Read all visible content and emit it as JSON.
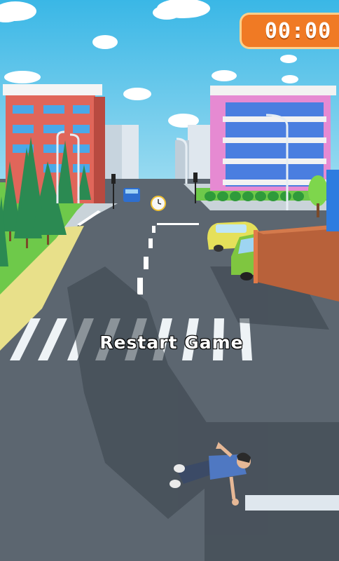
{
  "hud": {
    "timer": "00:00"
  },
  "menu": {
    "restart_label": "Restart Game"
  },
  "colors": {
    "sky": "#3fbbe6",
    "road": "#5c6670",
    "sidewalk": "#c9d3d9",
    "grass": "#6ec94a",
    "timer_bg": "#f07a24",
    "building_left": "#e0665a",
    "building_right": "#e68ad2",
    "truck_cargo": "#b8613a",
    "car_yellow": "#e5e05a"
  },
  "icons": {
    "timer_badge": "clock-badge",
    "bonus": "alarm-clock-icon"
  }
}
